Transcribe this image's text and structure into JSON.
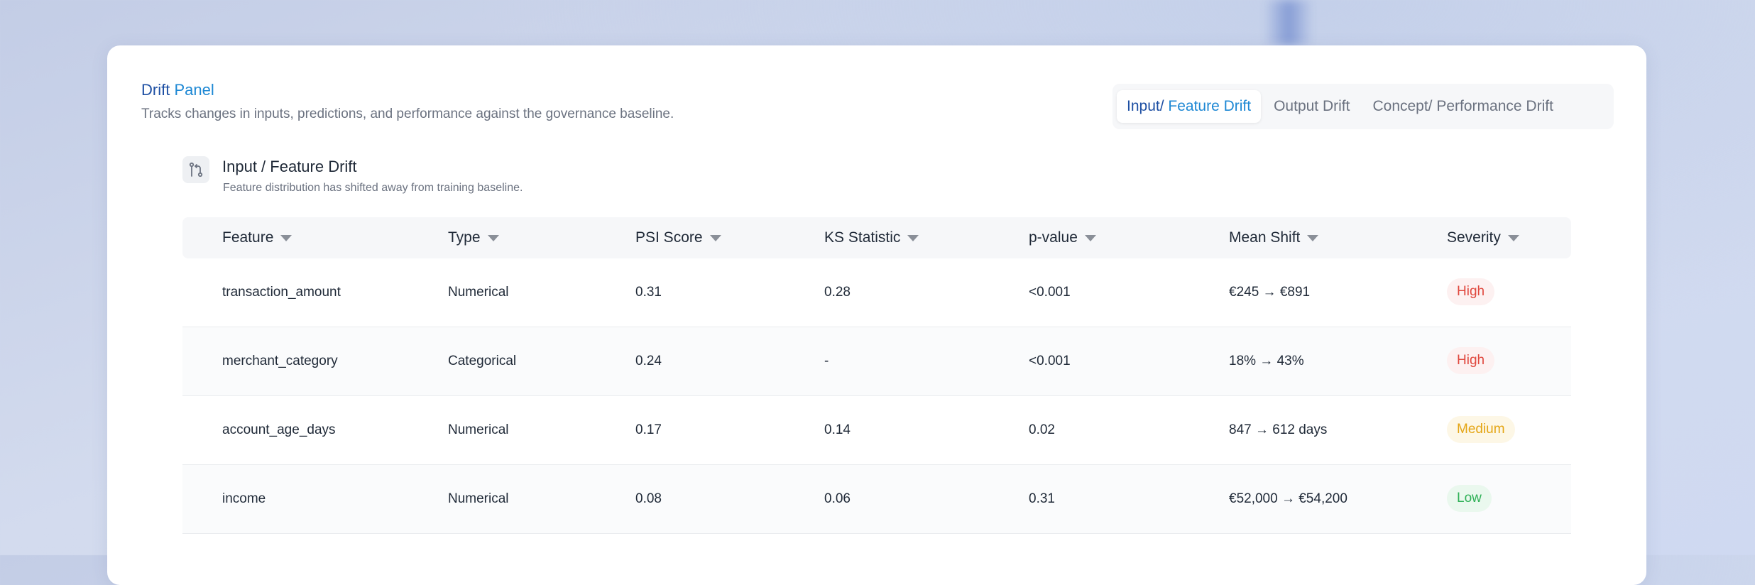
{
  "panel": {
    "title_main": "Drift",
    "title_accent": "Panel",
    "subtitle": "Tracks changes in inputs, predictions, and performance against the governance baseline."
  },
  "tabs": [
    {
      "label_main": "Input/",
      "label_accent": "Feature Drift",
      "active": true
    },
    {
      "label": "Output Drift",
      "active": false
    },
    {
      "label": "Concept/ Performance Drift",
      "active": false
    }
  ],
  "section": {
    "icon": "drift-compare-icon",
    "title": "Input / Feature Drift",
    "subtitle": "Feature distribution has shifted away from training baseline."
  },
  "table": {
    "columns": [
      "Feature",
      "Type",
      "PSI Score",
      "KS Statistic",
      "p-value",
      "Mean Shift",
      "Severity"
    ],
    "rows": [
      {
        "feature": "transaction_amount",
        "type": "Numerical",
        "psi": "0.31",
        "ks": "0.28",
        "p": "<0.001",
        "shift": "€245 → €891",
        "severity": "High"
      },
      {
        "feature": "merchant_category",
        "type": "Categorical",
        "psi": "0.24",
        "ks": "-",
        "p": "<0.001",
        "shift": "18% → 43%",
        "severity": "High"
      },
      {
        "feature": "account_age_days",
        "type": "Numerical",
        "psi": "0.17",
        "ks": "0.14",
        "p": "0.02",
        "shift": "847 → 612 days",
        "severity": "Medium"
      },
      {
        "feature": "income",
        "type": "Numerical",
        "psi": "0.08",
        "ks": "0.06",
        "p": "0.31",
        "shift": "€52,000 → €54,200",
        "severity": "Low"
      }
    ]
  },
  "colors": {
    "brand": "#1d4fa3",
    "accent": "#1e88d4",
    "high": "#e0483e",
    "medium": "#e4a514",
    "low": "#2fb157"
  }
}
